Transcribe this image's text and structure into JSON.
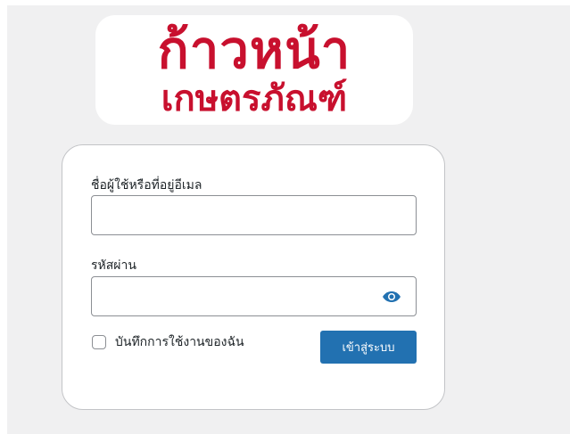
{
  "logo": {
    "line1": "ก้าวหน้า",
    "line2": "เกษตรภัณฑ์",
    "color": "#c8102e"
  },
  "form": {
    "username_label": "ชื่อผู้ใช้หรือที่อยู่อีเมล",
    "username_value": "",
    "password_label": "รหัสผ่าน",
    "password_value": "",
    "show_password_icon": "eye-icon",
    "remember_label": "บันทึกการใช้งานของฉัน",
    "remember_checked": false,
    "submit_label": "เข้าสู่ระบบ"
  },
  "colors": {
    "accent": "#2271b1",
    "background": "#f0f0f1"
  }
}
